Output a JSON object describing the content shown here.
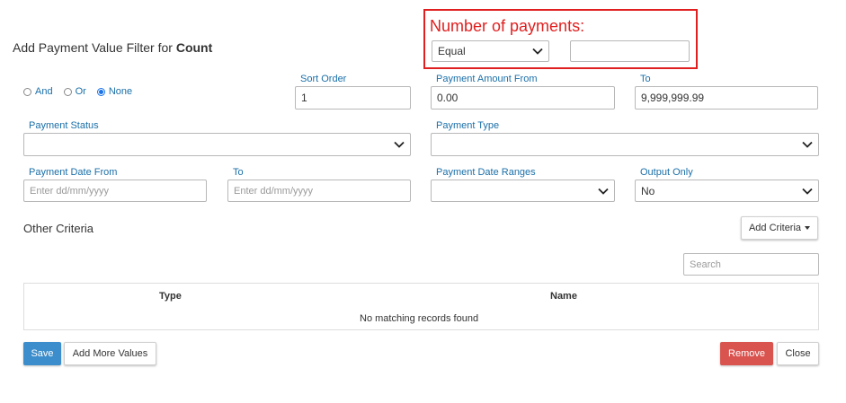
{
  "dialog": {
    "title_prefix": "Add Payment Value Filter for ",
    "title_bold": "Count"
  },
  "number_of_payments": {
    "label": "Number of payments:",
    "operator": "Equal",
    "value": ""
  },
  "logic": {
    "options": [
      "And",
      "Or",
      "None"
    ],
    "selected": "None"
  },
  "sort_order": {
    "label": "Sort Order",
    "value": "1"
  },
  "payment_amount_from": {
    "label": "Payment Amount From",
    "value": "0.00"
  },
  "payment_amount_to": {
    "label": "To",
    "value": "9,999,999.99"
  },
  "payment_status": {
    "label": "Payment Status",
    "value": ""
  },
  "payment_type": {
    "label": "Payment Type",
    "value": ""
  },
  "payment_date_from": {
    "label": "Payment Date From",
    "placeholder": "Enter dd/mm/yyyy"
  },
  "payment_date_to": {
    "label": "To",
    "placeholder": "Enter dd/mm/yyyy"
  },
  "payment_date_ranges": {
    "label": "Payment Date Ranges",
    "value": ""
  },
  "output_only": {
    "label": "Output Only",
    "value": "No"
  },
  "other_criteria": {
    "title": "Other Criteria",
    "add_button": "Add Criteria",
    "search_placeholder": "Search",
    "columns": [
      "Type",
      "Name"
    ],
    "empty_message": "No matching records found"
  },
  "footer": {
    "save": "Save",
    "add_more": "Add More Values",
    "remove": "Remove",
    "close": "Close"
  },
  "colors": {
    "accent": "#1a6fa8",
    "callout": "#e02020",
    "primary_button": "#3c8dcb",
    "danger_button": "#d9534f"
  }
}
